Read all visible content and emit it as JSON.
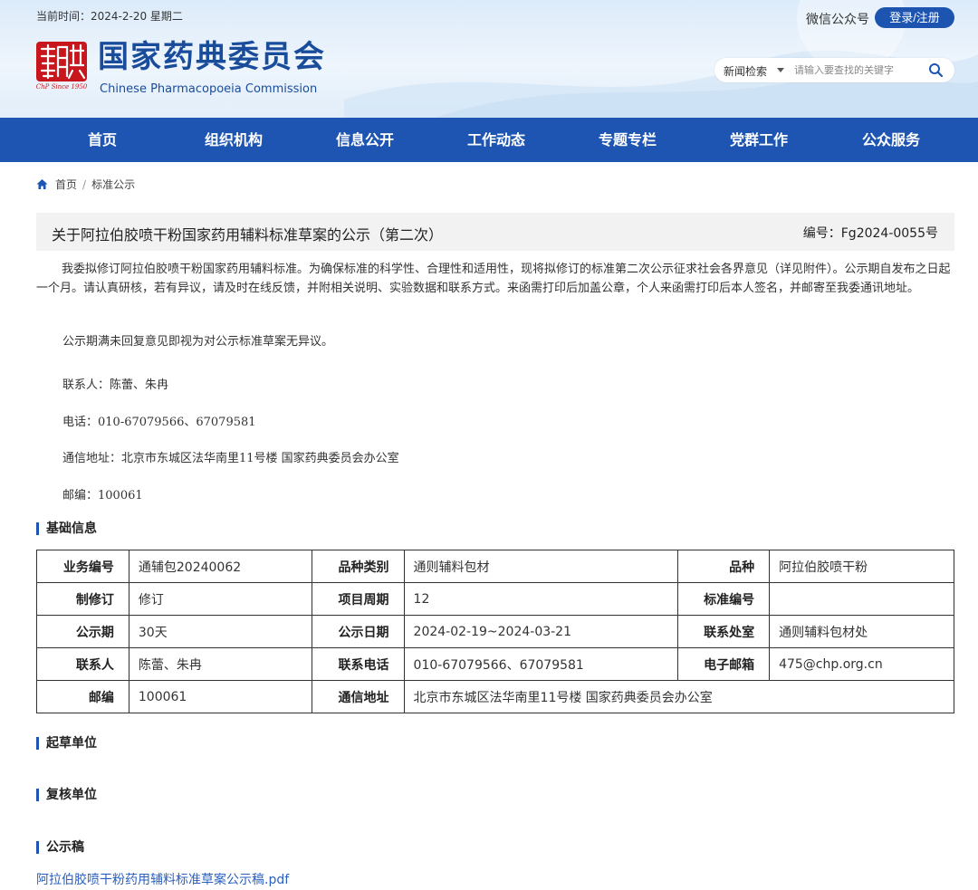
{
  "header": {
    "date_line": "当前时间：2024-2-20 星期二",
    "logo_cn": "国家药典委员会",
    "logo_en": "Chinese Pharmacopoeia Commission",
    "logo_seal_text": "ChP Since 1950",
    "wechat": "微信公众号",
    "login": "登录/注册",
    "search": {
      "select": "新闻检索",
      "placeholder": "请输入要查找的关键字"
    }
  },
  "nav": [
    "首页",
    "组织机构",
    "信息公开",
    "工作动态",
    "专题专栏",
    "党群工作",
    "公众服务"
  ],
  "breadcrumb": {
    "home": "首页",
    "sep": "/",
    "current": "标准公示"
  },
  "article": {
    "title": "关于阿拉伯胶喷干粉国家药用辅料标准草案的公示（第二次）",
    "code": "编号：Fg2024-0055号",
    "p1": "我委拟修订阿拉伯胶喷干粉国家药用辅料标准。为确保标准的科学性、合理性和适用性，现将拟修订的标准第二次公示征求社会各界意见（详见附件）。公示期自发布之日起一个月。请认真研核，若有异议，请及时在线反馈，并附相关说明、实验数据和联系方式。来函需打印后加盖公章，个人来函需打印后本人签名，并邮寄至我委通讯地址。",
    "p2": "公示期满未回复意见即视为对公示标准草案无异议。",
    "contact": "联系人：陈蕾、朱冉",
    "phone": "电话：010-67079566、67079581",
    "address": "通信地址：北京市东城区法华南里11号楼 国家药典委员会办公室",
    "zip": "邮编：100061"
  },
  "sections": {
    "basic": "基础信息",
    "draft_unit": "起草单位",
    "review_unit": "复核单位",
    "draft_doc": "公示稿"
  },
  "table": [
    [
      "业务编号",
      "通辅包20240062",
      "品种类别",
      "通则辅料包材",
      "品种",
      "阿拉伯胶喷干粉"
    ],
    [
      "制修订",
      "修订",
      "项目周期",
      "12",
      "标准编号",
      ""
    ],
    [
      "公示期",
      "30天",
      "公示日期",
      "2024-02-19~2024-03-21",
      "联系处室",
      "通则辅料包材处"
    ],
    [
      "联系人",
      "陈蕾、朱冉",
      "联系电话",
      "010-67079566、67079581",
      "电子邮箱",
      "475@chp.org.cn"
    ],
    [
      "邮编",
      "100061",
      "通信地址",
      "北京市东城区法华南里11号楼 国家药典委员会办公室"
    ]
  ],
  "attachment": "阿拉伯胶喷干粉药用辅料标准草案公示稿.pdf",
  "colors": {
    "brand": "#1e55b3",
    "seal": "#c8161d",
    "link": "#2a60c0"
  }
}
